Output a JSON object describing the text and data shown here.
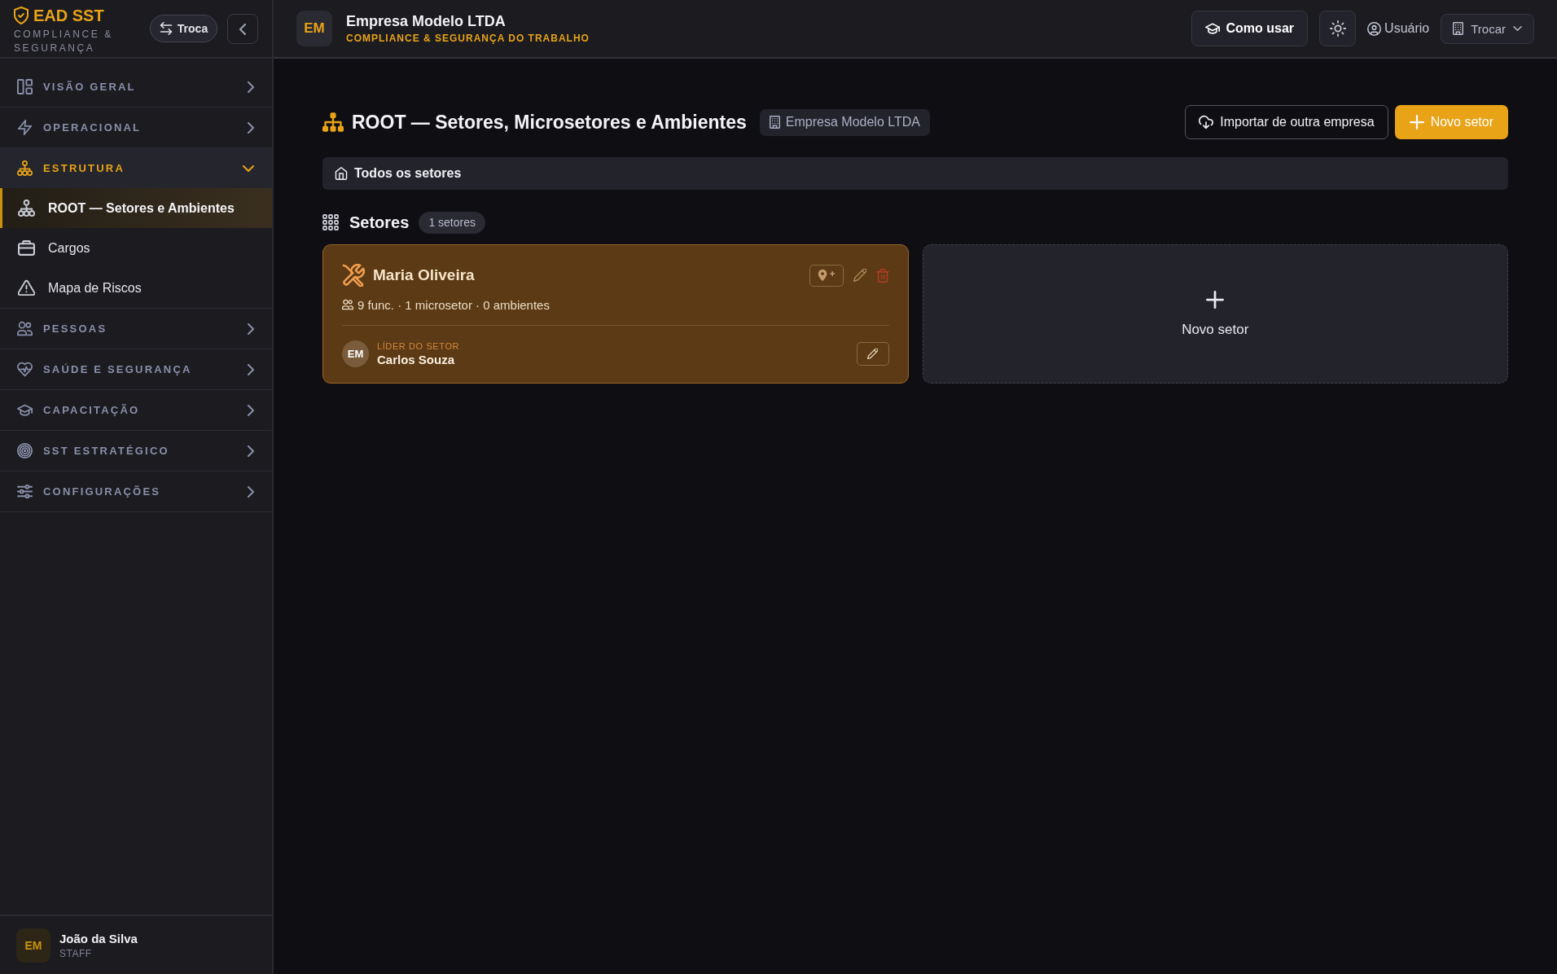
{
  "sidebar": {
    "brand": {
      "title": "EAD SST",
      "subtitle": "COMPLIANCE & SEGURANÇA"
    },
    "switch_button": {
      "label": "Troca"
    },
    "nav": [
      {
        "label": "VISÃO GERAL",
        "expanded": false
      },
      {
        "label": "OPERACIONAL",
        "expanded": false
      },
      {
        "label": "ESTRUTURA",
        "expanded": true,
        "children": [
          {
            "label": "ROOT — Setores e Ambientes",
            "selected": true
          },
          {
            "label": "Cargos",
            "selected": false
          },
          {
            "label": "Mapa de Riscos",
            "selected": false
          }
        ]
      },
      {
        "label": "PESSOAS",
        "expanded": false
      },
      {
        "label": "SAÚDE E SEGURANÇA",
        "expanded": false
      },
      {
        "label": "CAPACITAÇÃO",
        "expanded": false
      },
      {
        "label": "SST ESTRATÉGICO",
        "expanded": false
      },
      {
        "label": "CONFIGURAÇÕES",
        "expanded": false
      }
    ],
    "user": {
      "initials": "EM",
      "name": "João da Silva",
      "role": "STAFF"
    }
  },
  "topbar": {
    "company": {
      "initials": "EM",
      "name": "Empresa Modelo LTDA",
      "subtitle": "COMPLIANCE & SEGURANÇA DO TRABALHO"
    },
    "help_button": {
      "label": "Como usar"
    },
    "user_menu": {
      "label": "Usuário"
    },
    "switch_menu": {
      "label": "Trocar"
    }
  },
  "page": {
    "title": "ROOT — Setores, Microsetores e Ambientes",
    "company_badge": "Empresa Modelo LTDA",
    "actions": [
      {
        "label": "Importar de outra empresa",
        "kind": "secondary"
      },
      {
        "label": "Novo setor",
        "kind": "primary"
      }
    ],
    "breadcrumb": [
      {
        "label": "Todos os setores"
      }
    ],
    "section": {
      "title": "Setores",
      "count": "1 setores"
    },
    "sectors": [
      {
        "name": "Maria Oliveira",
        "stats": "9 func. · 1 microsetor · 0 ambientes",
        "leader": {
          "label": "LÍDER DO SETOR",
          "initials": "EM",
          "name": "Carlos Souza"
        }
      }
    ],
    "new_card": {
      "label": "Novo setor"
    }
  }
}
